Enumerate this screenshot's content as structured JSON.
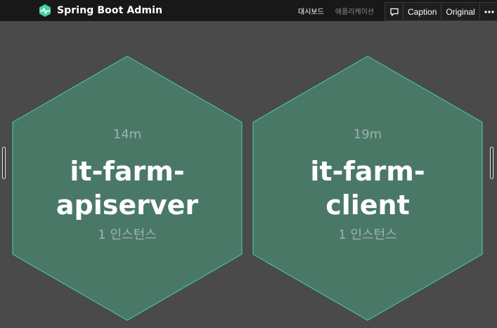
{
  "brand": {
    "title": "Spring Boot Admin",
    "icon": "heartbeat-icon",
    "accent_color": "#42d3a5"
  },
  "nav": {
    "items": [
      {
        "label": "대시보드",
        "active": true
      },
      {
        "label": "애플리케이션",
        "active": false
      }
    ]
  },
  "toolbar": {
    "comment_icon": "comment-icon",
    "caption_label": "Caption",
    "original_label": "Original",
    "more_icon": "more-icon"
  },
  "colors": {
    "background": "#4a4a4a",
    "navbar": "#181818",
    "hex_fill": "#4a7867",
    "hex_stroke": "#42d3a5"
  },
  "applications": [
    {
      "uptime": "14m",
      "name_line1": "it-farm-",
      "name_line2": "apiserver",
      "instances": "1 인스턴스"
    },
    {
      "uptime": "19m",
      "name_line1": "it-farm-",
      "name_line2": "client",
      "instances": "1 인스턴스"
    }
  ]
}
